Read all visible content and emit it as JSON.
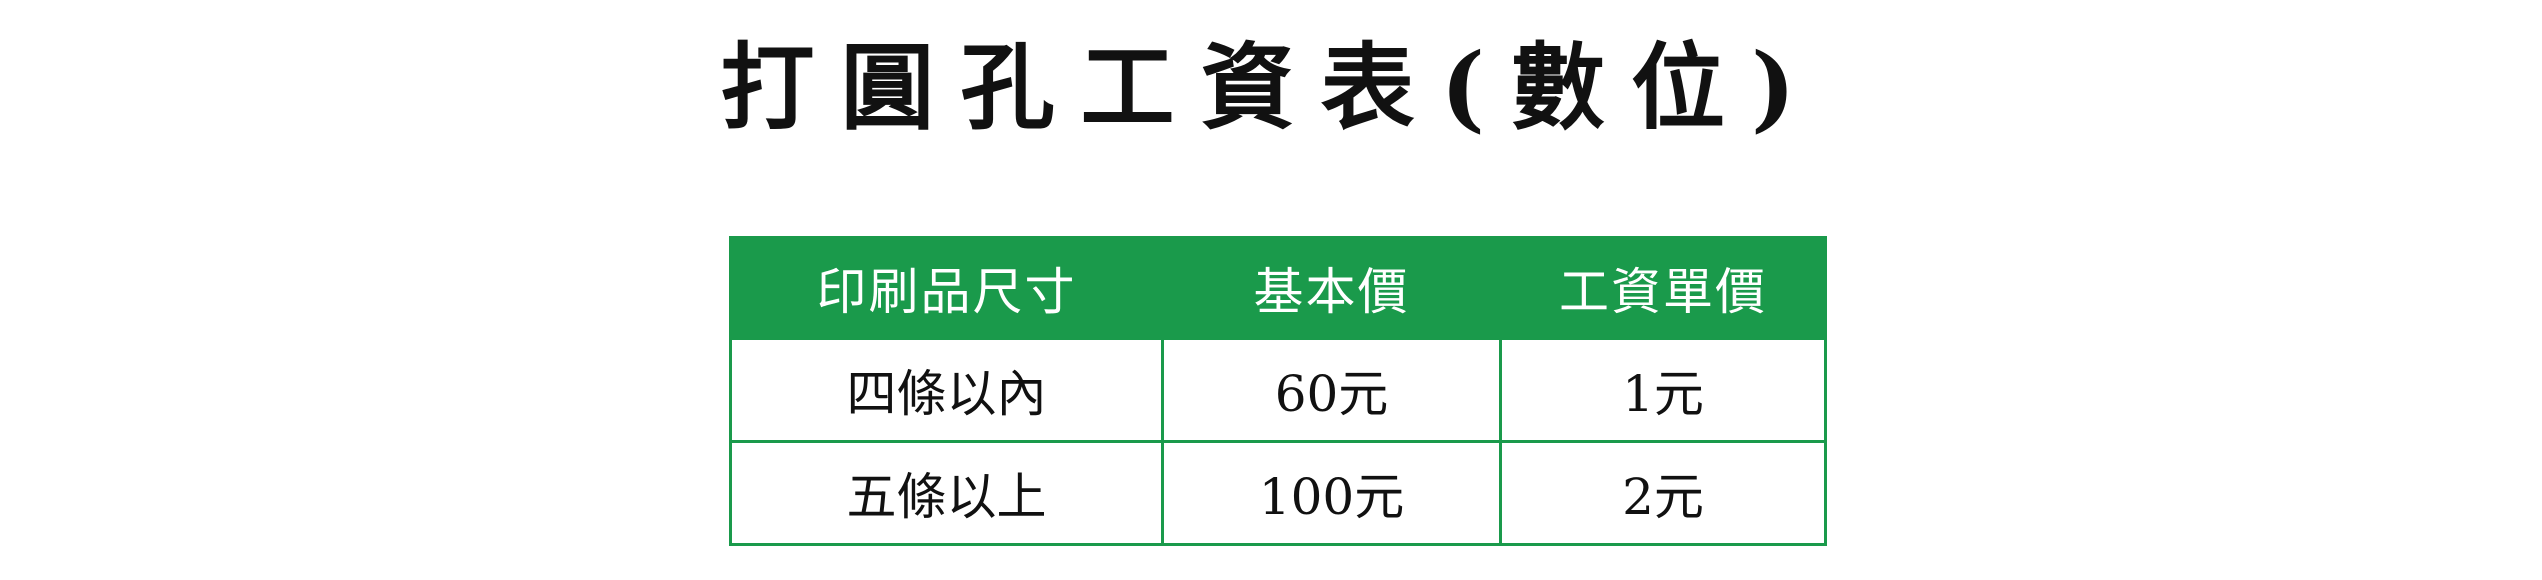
{
  "title": "打圓孔工資表(數位)",
  "table": {
    "headers": [
      "印刷品尺寸",
      "基本價",
      "工資單價"
    ],
    "rows": [
      [
        "四條以內",
        "60元",
        "1元"
      ],
      [
        "五條以上",
        "100元",
        "2元"
      ]
    ]
  },
  "colors": {
    "header_bg": "#1a9a4b",
    "header_text": "#ffffff",
    "border": "#1a9a4b",
    "body_text": "#111111"
  }
}
